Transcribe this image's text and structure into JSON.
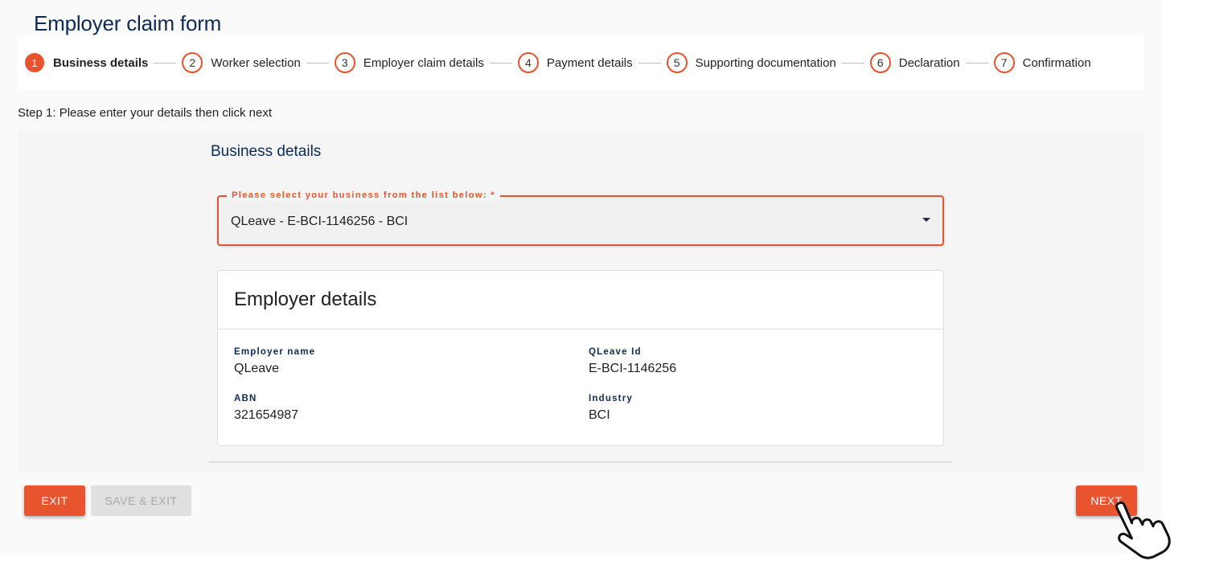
{
  "page": {
    "title": "Employer claim form"
  },
  "stepper": {
    "steps": [
      {
        "num": "1",
        "label": "Business details"
      },
      {
        "num": "2",
        "label": "Worker selection"
      },
      {
        "num": "3",
        "label": "Employer claim details"
      },
      {
        "num": "4",
        "label": "Payment details"
      },
      {
        "num": "5",
        "label": "Supporting documentation"
      },
      {
        "num": "6",
        "label": "Declaration"
      },
      {
        "num": "7",
        "label": "Confirmation"
      }
    ]
  },
  "instruction": "Step 1: Please enter your details then click next",
  "section": {
    "title": "Business details"
  },
  "business_select": {
    "label": "Please select your business from the list below: *",
    "value": "QLeave - E-BCI-1146256 - BCI"
  },
  "employer_details": {
    "title": "Employer details",
    "employer_name_label": "Employer name",
    "employer_name": "QLeave",
    "qleave_id_label": "QLeave Id",
    "qleave_id": "E-BCI-1146256",
    "abn_label": "ABN",
    "abn": "321654987",
    "industry_label": "Industry",
    "industry": "BCI"
  },
  "actions": {
    "exit": "EXIT",
    "save_exit": "SAVE & EXIT",
    "next": "NEXT"
  },
  "colors": {
    "accent": "#e8542d",
    "heading": "#0d2a55"
  }
}
